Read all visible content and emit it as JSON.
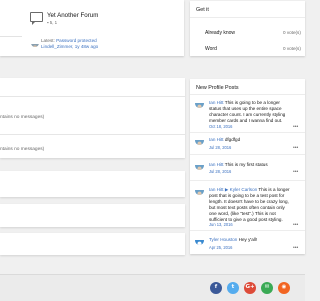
{
  "forum": {
    "title": "Yet Another Forum",
    "stats": "5, 1",
    "latest_prefix": "Latest:",
    "latest_thread": "Password protected",
    "latest_meta": "Lindell_Zimmer, 1y 48w ago"
  },
  "get_it": {
    "header": "Get it",
    "rows": [
      {
        "label": "Already know",
        "count": "0 vote(s)"
      },
      {
        "label": "Word",
        "count": "0 vote(s)"
      }
    ]
  },
  "left_panels": {
    "no_messages_1": "ntains no messages)",
    "no_messages_2": "ntains no messages)"
  },
  "profile_posts": {
    "header": "New Profile Posts",
    "posts": [
      {
        "author": "Ian Hitt",
        "text": "This is going to be a longer status that uses up the entire space character count. I am currently styling member cards and I wanna find out.",
        "date": "Oct 18, 2016",
        "more": "•••"
      },
      {
        "author": "Ian Hitt",
        "text": "dfgdfgd",
        "date": "Jul 28, 2016",
        "more": "•••"
      },
      {
        "author": "Ian Hitt",
        "text": "This is my first status",
        "date": "Jul 28, 2016",
        "more": "•••"
      },
      {
        "author": "Ian Hitt ▶ Kyler Carlson",
        "text": "This is a longer post that is going to be a test post for length. It doesn't have to be crazy long, but most text posts often contain only one word, (like \"test\".) This is not sufficient to give a good post styling.",
        "date": "Jun 13, 2016",
        "more": "•••"
      },
      {
        "author": "Tyler Houston",
        "text": "Hey y'all!",
        "date": "Apr 25, 2016",
        "more": "•••"
      }
    ]
  },
  "footer": {
    "share_buttons": [
      {
        "name": "facebook",
        "glyph": "f",
        "color": "#3b5998"
      },
      {
        "name": "twitter",
        "glyph": "t",
        "color": "#55acee"
      },
      {
        "name": "google-plus",
        "glyph": "G+",
        "color": "#dd4b39"
      },
      {
        "name": "email",
        "glyph": "✉",
        "color": "#3aaa55"
      },
      {
        "name": "rss",
        "glyph": "◉",
        "color": "#f26522"
      }
    ]
  },
  "colors": {
    "link": "#3a70c0",
    "muted": "#6a6a6a",
    "background": "#f0f0f0"
  }
}
